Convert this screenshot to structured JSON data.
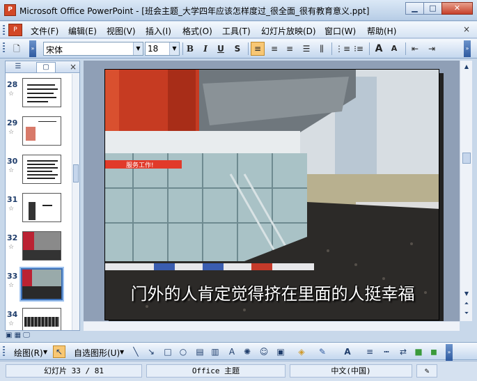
{
  "window": {
    "title": "Microsoft Office PowerPoint - [班会主题_大学四年应该怎样度过_很全面_很有教育意义.ppt]",
    "app_icon": "powerpoint-icon",
    "minimize": "minimize-icon",
    "maximize": "maximize-icon",
    "close": "close-icon"
  },
  "menubar": {
    "items": [
      "文件(F)",
      "编辑(E)",
      "视图(V)",
      "插入(I)",
      "格式(O)",
      "工具(T)",
      "幻灯片放映(D)",
      "窗口(W)",
      "帮助(H)"
    ],
    "close_glyph": "×"
  },
  "toolbar": {
    "font_name": "宋体",
    "font_size": "18",
    "bold": "B",
    "italic": "I",
    "underline": "U",
    "shadow": "S",
    "increase_font": "A",
    "decrease_font": "A"
  },
  "slide_pane": {
    "tabs": [
      "outline-tab-icon",
      "slides-tab-icon"
    ],
    "close_glyph": "×",
    "slides": [
      {
        "number": "28"
      },
      {
        "number": "29"
      },
      {
        "number": "30"
      },
      {
        "number": "31"
      },
      {
        "number": "32"
      },
      {
        "number": "33",
        "selected": true
      },
      {
        "number": "34"
      }
    ]
  },
  "current_slide": {
    "caption": "门外的人肯定觉得挤在里面的人挺幸福",
    "banner_text": "服务工作!"
  },
  "drawing_toolbar": {
    "draw_label": "绘图(R)",
    "autoshapes_label": "自选图形(U)"
  },
  "statusbar": {
    "slide_position": "幻灯片 33 / 81",
    "theme": "Office 主题",
    "language": "中文(中国)"
  },
  "colors": {
    "chrome": "#c8d8ea",
    "accent_orange": "#f8c774",
    "selection_blue": "#3b6fb6"
  }
}
